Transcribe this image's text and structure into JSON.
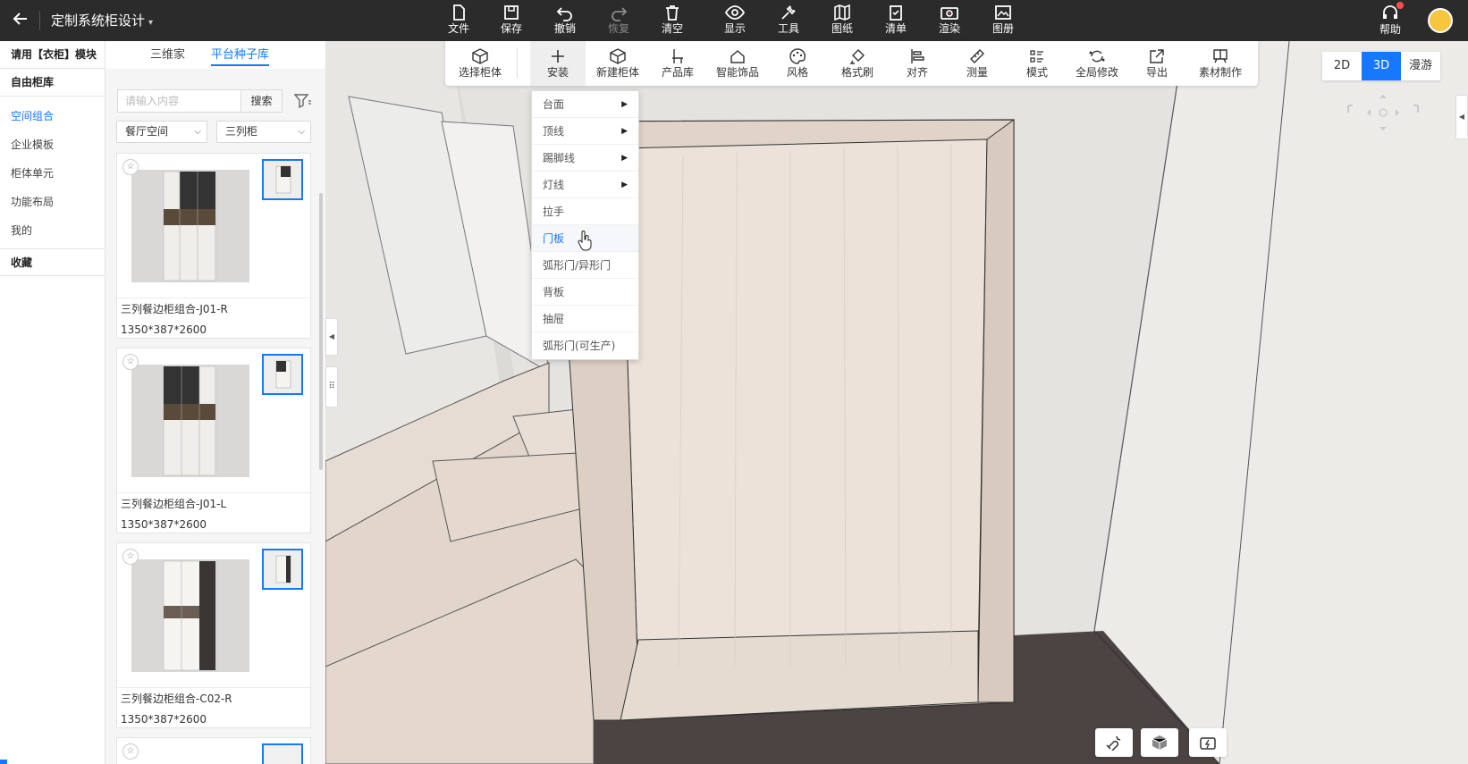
{
  "header": {
    "back_icon": "arrow-left-icon",
    "title": "定制系统柜设计",
    "menu": [
      {
        "label": "文件",
        "icon": "file-icon"
      },
      {
        "label": "保存",
        "icon": "save-icon"
      },
      {
        "label": "撤销",
        "icon": "undo-icon"
      },
      {
        "label": "恢复",
        "icon": "redo-icon",
        "disabled": true
      },
      {
        "label": "清空",
        "icon": "trash-icon"
      },
      {
        "label": "显示",
        "icon": "eye-icon"
      },
      {
        "label": "工具",
        "icon": "wrench-icon"
      },
      {
        "label": "图纸",
        "icon": "map-icon"
      },
      {
        "label": "清单",
        "icon": "clipboard-icon"
      },
      {
        "label": "渲染",
        "icon": "camera-icon"
      },
      {
        "label": "图册",
        "icon": "image-icon"
      }
    ],
    "help_label": "帮助",
    "help_icon": "headset-icon"
  },
  "leftnav": {
    "header": "请用【衣柜】模块",
    "section": "自由柜库",
    "items": [
      {
        "label": "空间组合",
        "active": true
      },
      {
        "label": "企业模板"
      },
      {
        "label": "柜体单元"
      },
      {
        "label": "功能布局"
      },
      {
        "label": "我的"
      }
    ],
    "favorites": "收藏"
  },
  "library": {
    "tabs": [
      {
        "label": "三维家"
      },
      {
        "label": "平台种子库",
        "active": true
      }
    ],
    "search_placeholder": "请输入内容",
    "search_button": "搜索",
    "filter_room": "餐厅空间",
    "filter_type": "三列柜",
    "products": [
      {
        "name": "三列餐边柜组合-J01-R",
        "size": "1350*387*2600"
      },
      {
        "name": "三列餐边柜组合-J01-L",
        "size": "1350*387*2600"
      },
      {
        "name": "三列餐边柜组合-C02-R",
        "size": "1350*387*2600"
      }
    ]
  },
  "toolbar2": [
    {
      "label": "选择柜体",
      "icon": "cube-select-icon"
    },
    {
      "label": "安装",
      "icon": "plus-icon",
      "active": true
    },
    {
      "label": "新建柜体",
      "icon": "cube-new-icon"
    },
    {
      "label": "产品库",
      "icon": "chair-icon"
    },
    {
      "label": "智能饰品",
      "icon": "home-icon"
    },
    {
      "label": "风格",
      "icon": "palette-icon"
    },
    {
      "label": "格式刷",
      "icon": "brush-icon"
    },
    {
      "label": "对齐",
      "icon": "align-icon"
    },
    {
      "label": "测量",
      "icon": "ruler-icon"
    },
    {
      "label": "模式",
      "icon": "list-icon"
    },
    {
      "label": "全局修改",
      "icon": "global-edit-icon"
    },
    {
      "label": "导出",
      "icon": "export-icon"
    },
    {
      "label": "素材制作",
      "icon": "material-icon"
    }
  ],
  "install_menu": [
    {
      "label": "台面",
      "submenu": true
    },
    {
      "label": "顶线",
      "submenu": true
    },
    {
      "label": "踢脚线",
      "submenu": true
    },
    {
      "label": "灯线",
      "submenu": true
    },
    {
      "label": "拉手"
    },
    {
      "label": "门板",
      "hover": true
    },
    {
      "label": "弧形门/异形门"
    },
    {
      "label": "背板"
    },
    {
      "label": "抽屉"
    },
    {
      "label": "弧形门(可生产)"
    }
  ],
  "view_modes": [
    {
      "label": "2D"
    },
    {
      "label": "3D",
      "active": true
    },
    {
      "label": "漫游"
    }
  ],
  "colors": {
    "topbar": "#2b2b2b",
    "accent": "#1677ff",
    "wood": "#e6d9cf",
    "floor": "#4a4340"
  }
}
